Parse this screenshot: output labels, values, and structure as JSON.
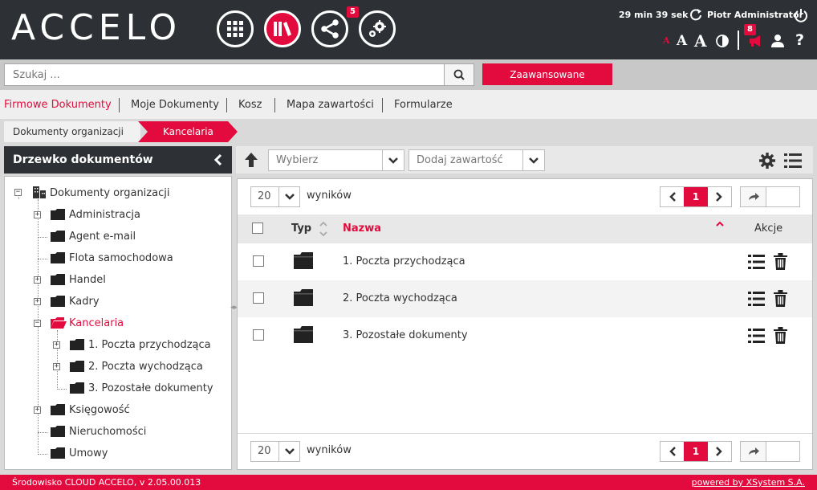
{
  "header": {
    "logo": "ACCELO",
    "nav_badge": "5",
    "timer": "29 min 39 sek",
    "user_name": "Piotr Administrator",
    "notify_badge": "8",
    "font_sizes": [
      "A",
      "A",
      "A"
    ],
    "help": "?"
  },
  "search": {
    "placeholder": "Szukaj ...",
    "advanced_label": "Zaawansowane"
  },
  "tabs": [
    {
      "label": "Firmowe Dokumenty",
      "active": true
    },
    {
      "label": "Moje Dokumenty"
    },
    {
      "label": "Kosz"
    },
    {
      "label": "Mapa zawartości"
    },
    {
      "label": "Formularze"
    }
  ],
  "breadcrumb": [
    "Dokumenty organizacji",
    "Kancelaria"
  ],
  "sidebar": {
    "title": "Drzewko dokumentów",
    "tree": [
      {
        "label": "Dokumenty organizacji"
      },
      {
        "label": "Administracja"
      },
      {
        "label": "Agent e-mail"
      },
      {
        "label": "Flota samochodowa"
      },
      {
        "label": "Handel"
      },
      {
        "label": "Kadry"
      },
      {
        "label": "Kancelaria",
        "selected": true
      },
      {
        "label": "1. Poczta przychodząca"
      },
      {
        "label": "2. Poczta wychodząca"
      },
      {
        "label": "3. Pozostałe dokumenty"
      },
      {
        "label": "Księgowość"
      },
      {
        "label": "Nieruchomości"
      },
      {
        "label": "Umowy"
      }
    ]
  },
  "toolbar": {
    "select_placeholder": "Wybierz",
    "add_placeholder": "Dodaj zawartość"
  },
  "list": {
    "page_size": "20",
    "results_label": "wyników",
    "current_page": "1",
    "columns": {
      "type": "Typ",
      "name": "Nazwa",
      "actions": "Akcje"
    },
    "rows": [
      {
        "name": "1. Poczta przychodząca"
      },
      {
        "name": "2. Poczta wychodząca"
      },
      {
        "name": "3. Pozostałe dokumenty"
      }
    ]
  },
  "footer": {
    "left": "Środowisko CLOUD ACCELO,  v 2.05.00.013",
    "right": "powered by XSystem S.A."
  },
  "colors": {
    "accent": "#e30b3d",
    "header_bg": "#2d3035"
  }
}
